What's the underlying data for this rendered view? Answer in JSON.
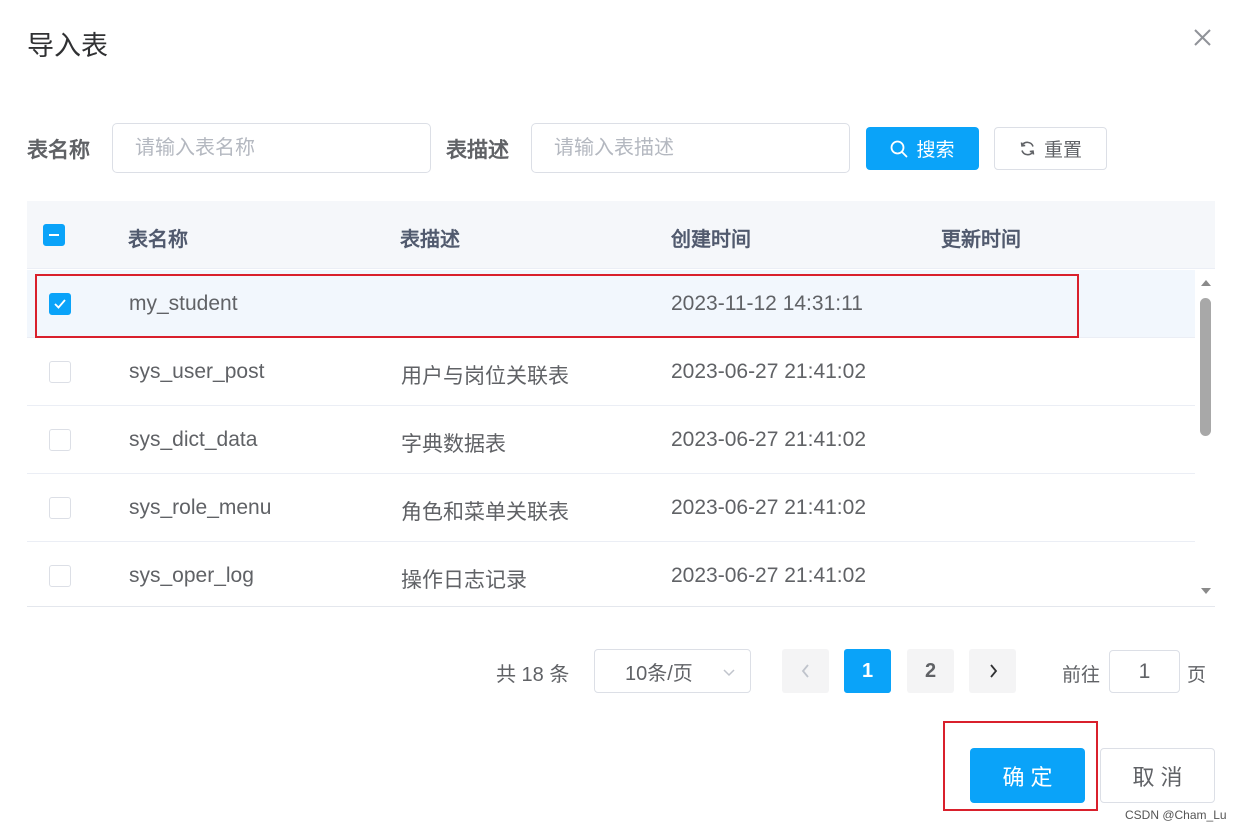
{
  "dialog": {
    "title": "导入表",
    "close_icon": "close-icon"
  },
  "filters": {
    "table_name_label": "表名称",
    "table_name_placeholder": "请输入表名称",
    "table_desc_label": "表描述",
    "table_desc_placeholder": "请输入表描述",
    "search_label": "搜索",
    "search_icon": "search-icon",
    "reset_label": "重置",
    "reset_icon": "refresh-icon"
  },
  "table": {
    "headers": {
      "name": "表名称",
      "desc": "表描述",
      "create_time": "创建时间",
      "update_time": "更新时间"
    },
    "rows": [
      {
        "name": "my_student",
        "desc": "",
        "create_time": "2023-11-12 14:31:11",
        "update_time": "",
        "selected": true
      },
      {
        "name": "sys_user_post",
        "desc": "用户与岗位关联表",
        "create_time": "2023-06-27 21:41:02",
        "update_time": "",
        "selected": false
      },
      {
        "name": "sys_dict_data",
        "desc": "字典数据表",
        "create_time": "2023-06-27 21:41:02",
        "update_time": "",
        "selected": false
      },
      {
        "name": "sys_role_menu",
        "desc": "角色和菜单关联表",
        "create_time": "2023-06-27 21:41:02",
        "update_time": "",
        "selected": false
      },
      {
        "name": "sys_oper_log",
        "desc": "操作日志记录",
        "create_time": "2023-06-27 21:41:02",
        "update_time": "",
        "selected": false
      }
    ]
  },
  "pagination": {
    "total_text": "共 18 条",
    "page_size": "10条/页",
    "pages": [
      "1",
      "2"
    ],
    "current_page": "1",
    "goto_label": "前往",
    "goto_value": "1",
    "goto_unit": "页"
  },
  "footer": {
    "confirm_label": "确定",
    "cancel_label": "取消"
  },
  "watermark": "CSDN @Cham_Lu",
  "colors": {
    "primary": "#0aa3f9",
    "highlight_border": "#d9202c",
    "selected_row_bg": "#f2f7fd"
  }
}
